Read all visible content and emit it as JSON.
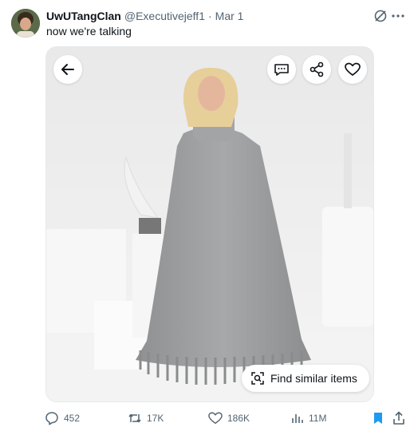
{
  "post": {
    "display_name": "UwUTangClan",
    "handle": "@Executivejeff1",
    "separator": "·",
    "date": "Mar 1",
    "text": "now we're talking"
  },
  "media": {
    "similar_items_label": "Find similar items"
  },
  "actions": {
    "replies": "452",
    "reposts": "17K",
    "likes": "186K",
    "views": "11M"
  },
  "colors": {
    "text_primary": "#0f1419",
    "text_secondary": "#536471",
    "bookmark_active": "#1d9bf0",
    "sweater_gray": "#9a9b9d"
  },
  "icons": [
    "grok-icon",
    "more-icon",
    "back-arrow-icon",
    "alt-text-icon",
    "share-icon",
    "heart-icon",
    "lens-search-icon",
    "reply-icon",
    "repost-icon",
    "like-icon",
    "views-icon",
    "bookmark-icon",
    "share-upload-icon"
  ]
}
